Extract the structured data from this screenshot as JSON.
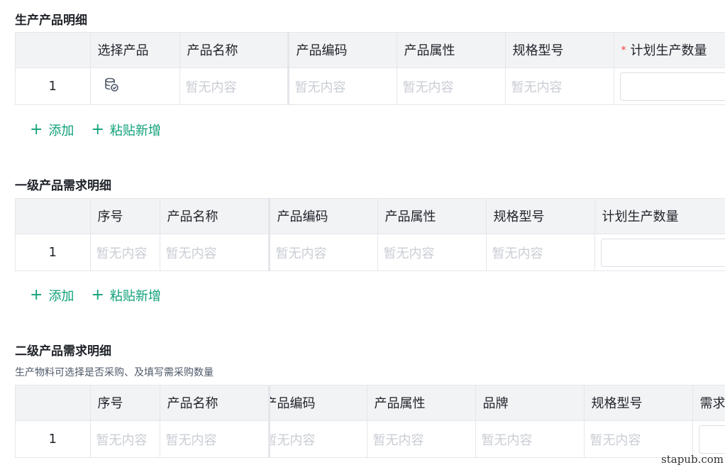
{
  "section1": {
    "title": "生产产品明细",
    "headers": [
      "",
      "选择产品",
      "产品名称",
      "产品编码",
      "产品属性",
      "规格型号",
      "计划生产数量"
    ],
    "required_mark": "*",
    "row": {
      "index": "1",
      "empty": "暂无内容"
    },
    "select_icon": "database-check-icon",
    "actions": {
      "add": "添加",
      "paste": "粘贴新增"
    }
  },
  "section2": {
    "title": "一级产品需求明细",
    "headers": [
      "",
      "序号",
      "产品名称",
      "产品编码",
      "产品属性",
      "规格型号",
      "计划生产数量"
    ],
    "row": {
      "index": "1",
      "empty": "暂无内容"
    },
    "actions": {
      "add": "添加",
      "paste": "粘贴新增"
    }
  },
  "section3": {
    "title": "二级产品需求明细",
    "description": "生产物料可选择是否采购、及填写需采购数量",
    "headers": [
      "",
      "序号",
      "产品名称",
      "产品编码",
      "产品属性",
      "品牌",
      "规格型号",
      "需求"
    ],
    "row": {
      "index": "1",
      "empty": "暂无内容"
    }
  },
  "colors": {
    "accent": "#0fa07a",
    "required": "#f53f3f",
    "placeholder": "#c9cdd4",
    "header_bg": "#f2f3f5"
  },
  "watermark": "stapub.com"
}
